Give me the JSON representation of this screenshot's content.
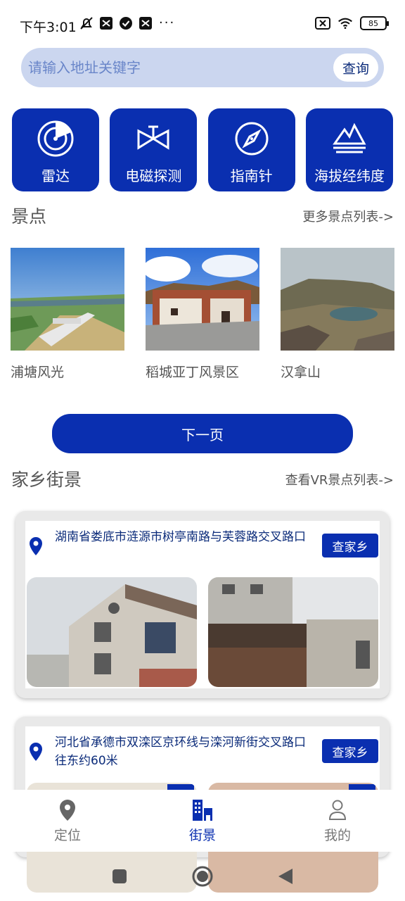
{
  "status_bar": {
    "time": "下午3:01",
    "dots": "···",
    "battery": "85"
  },
  "search": {
    "placeholder": "请输入地址关键字",
    "button": "查询"
  },
  "tools": [
    {
      "label": "雷达",
      "icon": "radar-icon"
    },
    {
      "label": "电磁探测",
      "icon": "electromagnetic-icon"
    },
    {
      "label": "指南针",
      "icon": "compass-icon"
    },
    {
      "label": "海拔经纬度",
      "icon": "altitude-icon"
    }
  ],
  "scenic": {
    "title": "景点",
    "more_link": "更多景点列表->",
    "spots": [
      {
        "name": "浦塘风光"
      },
      {
        "name": "稻城亚丁风景区"
      },
      {
        "name": "汉拿山"
      }
    ],
    "next_button": "下一页"
  },
  "street": {
    "title": "家乡街景",
    "more_link": "查看VR景点列表->",
    "cards": [
      {
        "address": "湖南省娄底市涟源市树亭南路与芙蓉路交叉路口",
        "button": "查家乡"
      },
      {
        "address": "河北省承德市双滦区京环线与滦河新街交叉路口往东约60米",
        "button": "查家乡"
      }
    ]
  },
  "bottom_nav": [
    {
      "label": "定位",
      "icon": "location-pin-icon",
      "active": false
    },
    {
      "label": "街景",
      "icon": "buildings-icon",
      "active": true
    },
    {
      "label": "我的",
      "icon": "person-icon",
      "active": false
    }
  ],
  "colors": {
    "primary": "#0a2fb0",
    "search_bg": "#cbd6ef",
    "text_link": "#0b2b7a"
  }
}
